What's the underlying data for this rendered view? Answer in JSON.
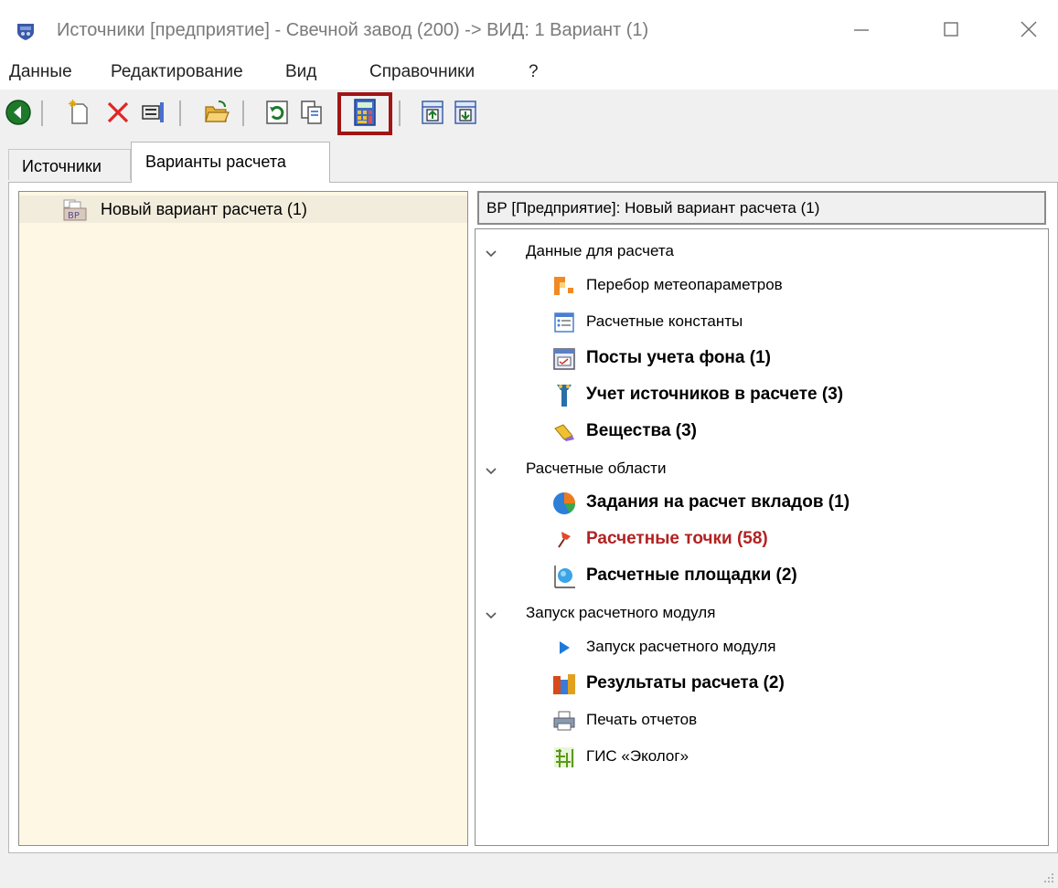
{
  "window": {
    "title": "Источники [предприятие] - Свечной завод (200) -> ВИД: 1 Вариант (1)",
    "minimize_glyph": "—",
    "maximize_glyph": "☐",
    "close_glyph": "✕"
  },
  "menu": {
    "items": [
      "Данные",
      "Редактирование",
      "Вид",
      "Справочники",
      "?"
    ]
  },
  "toolbar": {
    "buttons": [
      "back-icon",
      "new-doc-icon",
      "delete-icon",
      "properties-icon",
      "open-folder-icon",
      "refresh-icon",
      "copy-icon",
      "calculator-icon",
      "import-icon",
      "export-icon"
    ],
    "highlighted": "calculator-icon",
    "highlight_color": "#a01515"
  },
  "tabs": [
    {
      "label": "Источники",
      "active": false
    },
    {
      "label": "Варианты расчета",
      "active": true
    }
  ],
  "left_panel": {
    "items": [
      {
        "label": "Новый вариант расчета (1)",
        "icon_text": "BP"
      }
    ]
  },
  "right_panel": {
    "header": "ВР [Предприятие]: Новый вариант расчета (1)",
    "groups": [
      {
        "label": "Данные для расчета",
        "items": [
          {
            "label": "Перебор метеопараметров",
            "icon": "meteo-icon",
            "bold": false
          },
          {
            "label": "Расчетные константы",
            "icon": "constants-icon",
            "bold": false
          },
          {
            "label": "Посты учета фона (1)",
            "icon": "background-posts-icon",
            "bold": true
          },
          {
            "label": "Учет источников в расчете (3)",
            "icon": "sources-icon",
            "bold": true
          },
          {
            "label": "Вещества (3)",
            "icon": "substances-icon",
            "bold": true
          }
        ]
      },
      {
        "label": "Расчетные области",
        "items": [
          {
            "label": "Задания на расчет вкладов (1)",
            "icon": "pie-chart-icon",
            "bold": true
          },
          {
            "label": "Расчетные точки (58)",
            "icon": "pin-icon",
            "bold": true,
            "color": "#b22222"
          },
          {
            "label": "Расчетные площадки (2)",
            "icon": "area-icon",
            "bold": true
          }
        ]
      },
      {
        "label": "Запуск расчетного модуля",
        "items": [
          {
            "label": "Запуск расчетного модуля",
            "icon": "play-icon",
            "bold": false
          },
          {
            "label": "Результаты расчета (2)",
            "icon": "results-icon",
            "bold": true
          },
          {
            "label": "Печать отчетов",
            "icon": "printer-icon",
            "bold": false
          },
          {
            "label": "ГИС «Эколог»",
            "icon": "gis-icon",
            "bold": false
          }
        ]
      }
    ]
  },
  "status": {
    "text": ""
  }
}
